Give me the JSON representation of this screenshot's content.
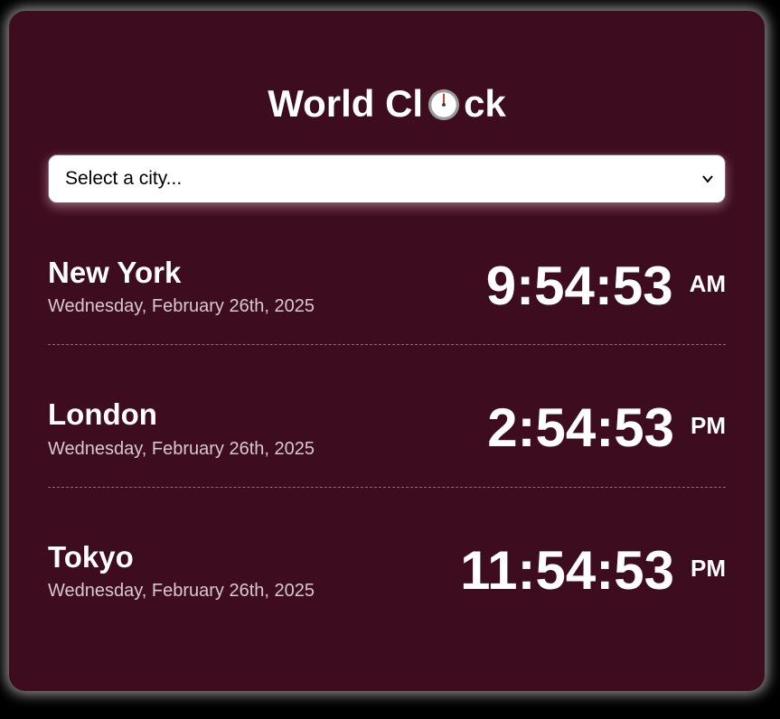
{
  "title": {
    "before": "World Cl",
    "icon": "stopwatch-icon",
    "after": "ck"
  },
  "city_select": {
    "selected": "Select a city..."
  },
  "cities": [
    {
      "name": "New York",
      "date": "Wednesday, February 26th, 2025",
      "time": "9:54:53",
      "ampm": "AM"
    },
    {
      "name": "London",
      "date": "Wednesday, February 26th, 2025",
      "time": "2:54:53",
      "ampm": "PM"
    },
    {
      "name": "Tokyo",
      "date": "Wednesday, February 26th, 2025",
      "time": "11:54:53",
      "ampm": "PM"
    }
  ],
  "colors": {
    "background": "#000000",
    "card": "#3d0c1e",
    "text": "#ffffff",
    "date_text": "#d8c8cf",
    "divider": "#8e6a78"
  }
}
